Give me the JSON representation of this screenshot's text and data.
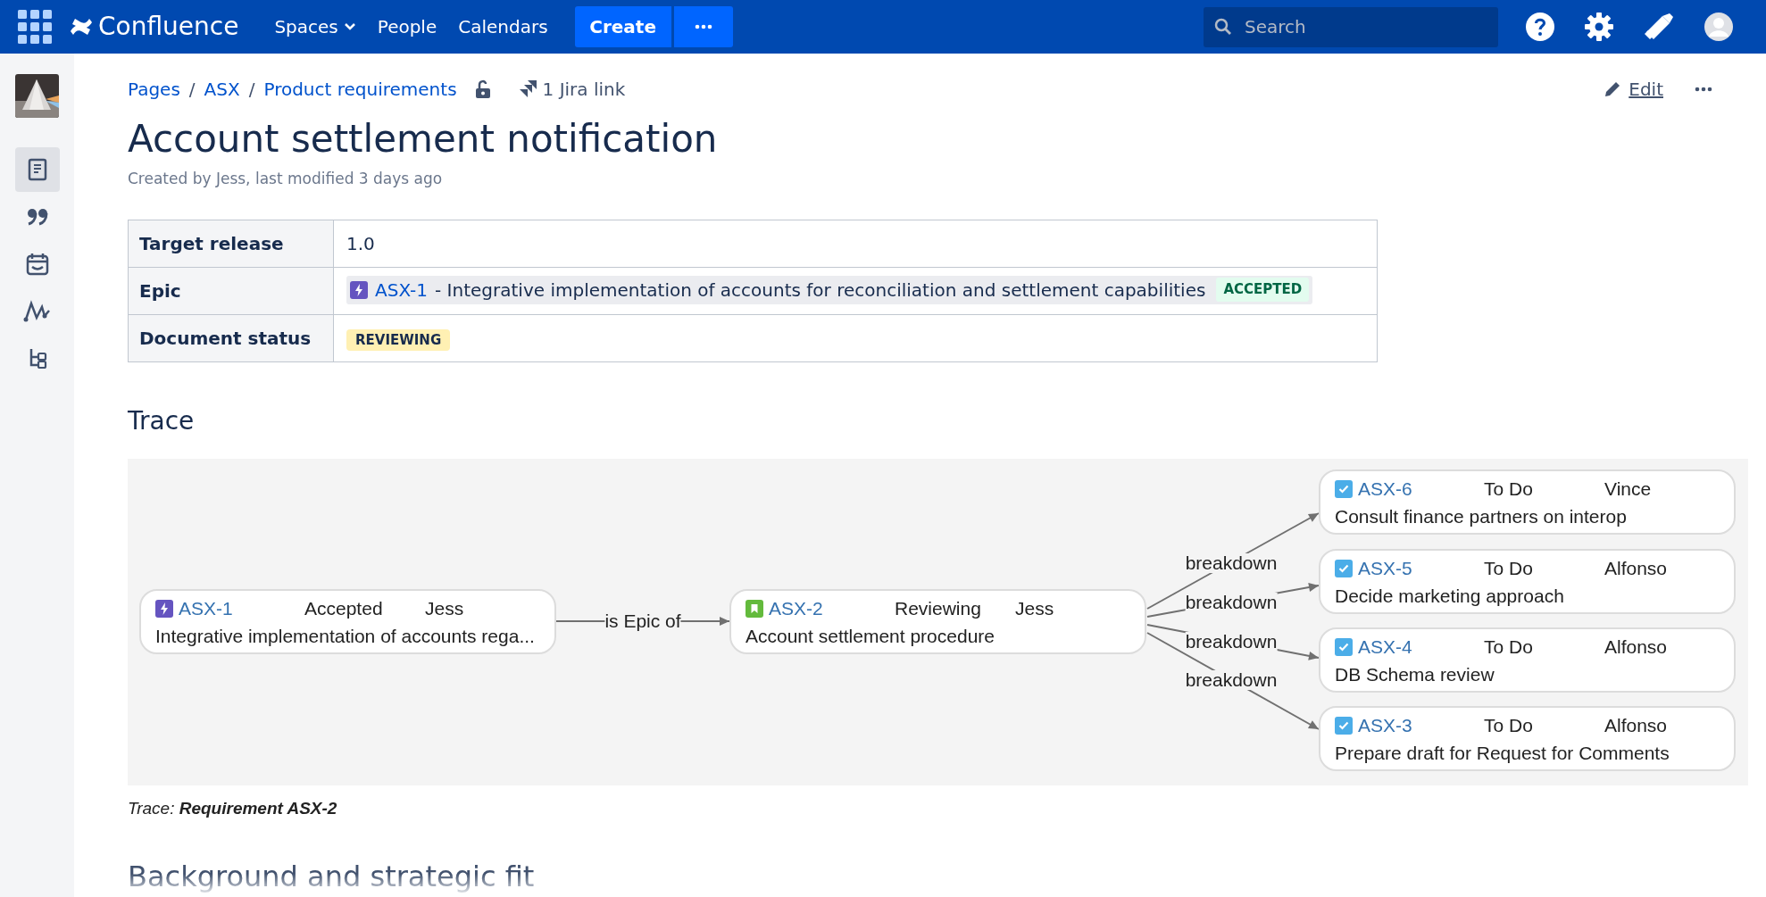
{
  "topbar": {
    "product": "Confluence",
    "nav": [
      {
        "label": "Spaces",
        "dropdown": true
      },
      {
        "label": "People",
        "dropdown": false
      },
      {
        "label": "Calendars",
        "dropdown": false
      }
    ],
    "create": "Create",
    "search": {
      "placeholder": "Search"
    }
  },
  "sidebar": {
    "items": [
      {
        "selected": true
      },
      {
        "selected": false
      },
      {
        "selected": false
      },
      {
        "selected": false
      },
      {
        "selected": false
      }
    ]
  },
  "breadcrumbs": [
    {
      "label": "Pages"
    },
    {
      "separator": "/",
      "label": "ASX"
    },
    {
      "separator": "/",
      "label": "Product requirements"
    }
  ],
  "jira_link": "1 Jira link",
  "edit": "Edit",
  "page": {
    "title": "Account settlement notification",
    "byline": "Created by Jess, last modified 3 days ago"
  },
  "properties": [
    {
      "label": "Target release",
      "kind": "text",
      "value": "1.0"
    },
    {
      "label": "Epic",
      "kind": "issue",
      "key": "ASX-1",
      "summary": "- Integrative implementation of accounts for reconciliation and settlement capabilities",
      "status": "ACCEPTED",
      "color": "#e3fcef"
    },
    {
      "label": "Document status",
      "kind": "status",
      "status": "REVIEWING",
      "color": "#fff0b3"
    }
  ],
  "trace": {
    "heading": "Trace",
    "nodes": [
      {
        "kind": "epic",
        "key": "ASX-1",
        "status": "Accepted",
        "assignee": "Jess",
        "summary": "Integrative implementation of accounts rega..."
      },
      {
        "kind": "story",
        "key": "ASX-2",
        "status": "Reviewing",
        "assignee": "Jess",
        "summary": "Account settlement procedure"
      },
      {
        "kind": "task",
        "key": "ASX-6",
        "status": "To Do",
        "assignee": "Vince",
        "summary": "Consult finance partners on interop"
      },
      {
        "kind": "task",
        "key": "ASX-5",
        "status": "To Do",
        "assignee": "Alfonso",
        "summary": "Decide marketing approach"
      },
      {
        "kind": "task",
        "key": "ASX-4",
        "status": "To Do",
        "assignee": "Alfonso",
        "summary": "DB Schema review"
      },
      {
        "kind": "task",
        "key": "ASX-3",
        "status": "To Do",
        "assignee": "Alfonso",
        "summary": "Prepare draft for Request for Comments"
      }
    ],
    "edges": [
      {
        "label": "is Epic of"
      },
      {
        "label": "breakdown"
      },
      {
        "label": "breakdown"
      },
      {
        "label": "breakdown"
      },
      {
        "label": "breakdown"
      }
    ],
    "caption": "Trace: **Requirement ASX-2**"
  },
  "next_heading": "Background and strategic fit"
}
